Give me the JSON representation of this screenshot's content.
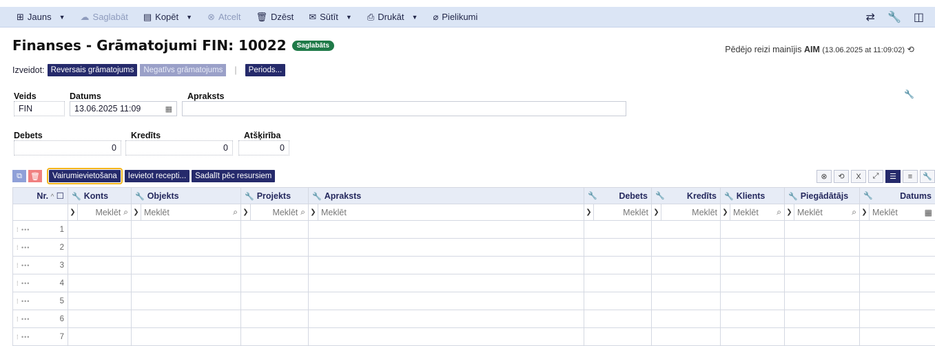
{
  "toolbar": {
    "new": "Jauns",
    "save": "Saglabāt",
    "copy": "Kopēt",
    "cancel": "Atcelt",
    "delete": "Dzēst",
    "send": "Sūtīt",
    "print": "Drukāt",
    "attachments": "Pielikumi"
  },
  "header": {
    "title": "Finanses - Grāmatojumi FIN: 10022",
    "badge": "Saglabāts",
    "lastmod_prefix": "Pēdējo reizi mainījis",
    "lastmod_user": "AIM",
    "lastmod_time": "(13.06.2025 at 11:09:02)"
  },
  "create": {
    "label": "Izveidot:",
    "reverse": "Reversais grāmatojums",
    "negative": "Negatīvs grāmatojums",
    "periods": "Periods..."
  },
  "form": {
    "type_label": "Veids",
    "type_value": "FIN",
    "date_label": "Datums",
    "date_value": "13.06.2025 11:09",
    "desc_label": "Apraksts",
    "desc_value": "",
    "debit_label": "Debets",
    "debit_value": "0",
    "credit_label": "Kredīts",
    "credit_value": "0",
    "diff_label": "Atšķirība",
    "diff_value": "0"
  },
  "grid_buttons": {
    "bulk": "Vairumievietošana",
    "recipe": "Ievietot recepti...",
    "split": "Sadalīt pēc resursiem"
  },
  "columns": {
    "nr": "Nr.",
    "account": "Konts",
    "object": "Objekts",
    "project": "Projekts",
    "description": "Apraksts",
    "debit": "Debets",
    "credit": "Kredīts",
    "client": "Klients",
    "supplier": "Piegādātājs",
    "date": "Datums"
  },
  "search_placeholder": "Meklēt",
  "rows": [
    "1",
    "2",
    "3",
    "4",
    "5",
    "6",
    "7"
  ],
  "colors": {
    "accent": "#252a6b",
    "toolbar": "#dbe5f5",
    "saved_badge": "#1f7a48",
    "highlight": "#f2b31a"
  }
}
